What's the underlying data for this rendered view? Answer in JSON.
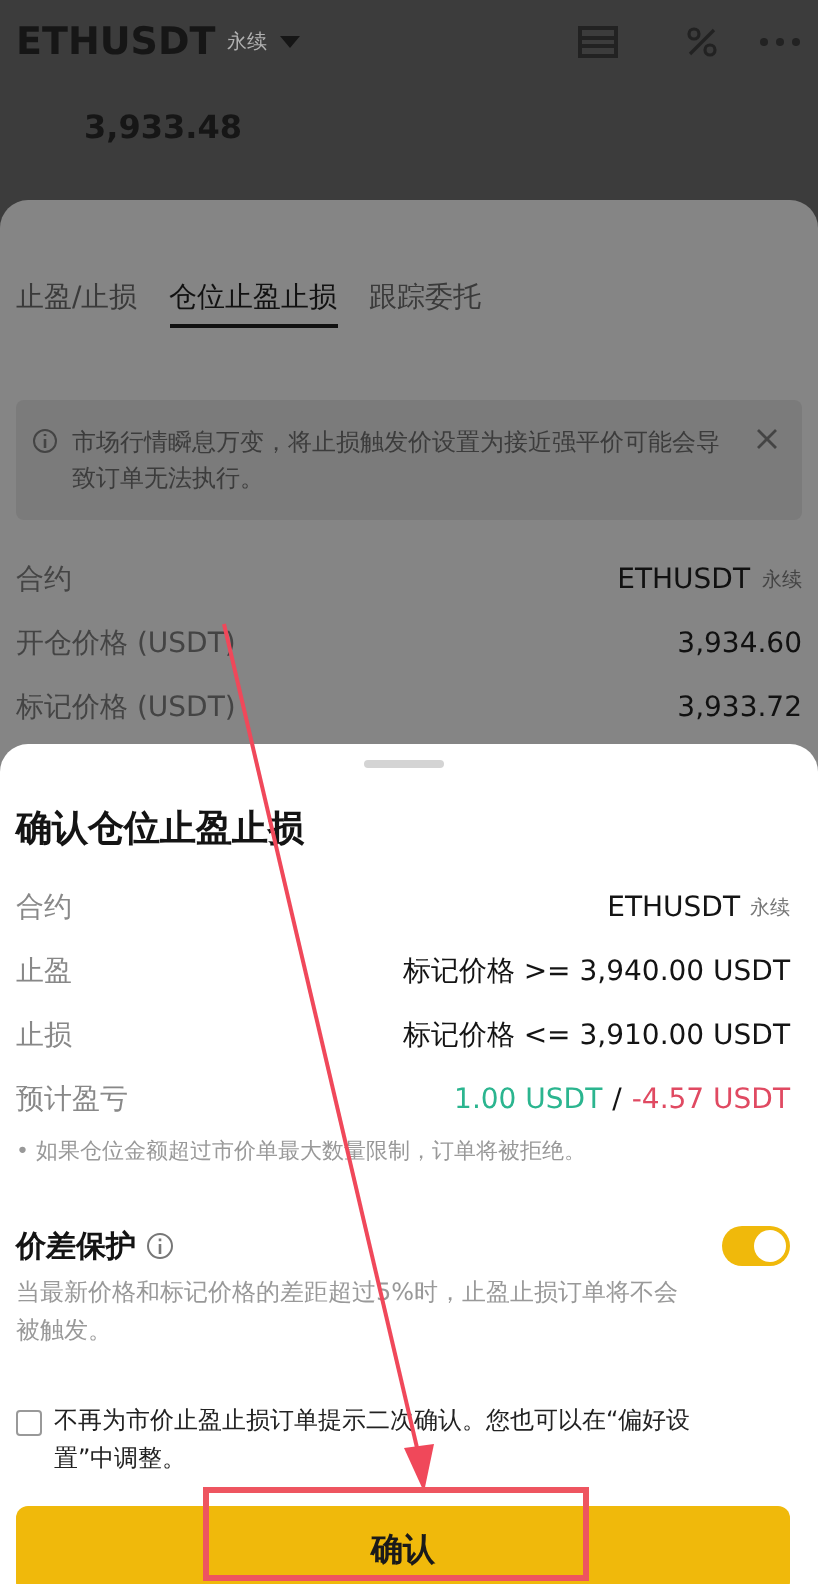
{
  "header": {
    "symbol": "ETHUSDT",
    "contract_type": "永续",
    "price": "3,933.48"
  },
  "tpsl_sheet": {
    "tabs": [
      {
        "label": "止盈/止损",
        "selected": false
      },
      {
        "label": "仓位止盈止损",
        "selected": true
      },
      {
        "label": "跟踪委托",
        "selected": false
      }
    ],
    "notice": "市场行情瞬息万变，将止损触发价设置为接近强平价可能会导致订单无法执行。",
    "rows": [
      {
        "label": "合约",
        "value": "ETHUSDT",
        "tag": "永续"
      },
      {
        "label": "开仓价格 (USDT)",
        "value": "3,934.60"
      },
      {
        "label": "标记价格 (USDT)",
        "value": "3,933.72"
      }
    ]
  },
  "confirm_dialog": {
    "title": "确认仓位止盈止损",
    "rows": [
      {
        "kind": "contract",
        "label": "合约",
        "value": "ETHUSDT",
        "tag": "永续"
      },
      {
        "kind": "plain",
        "label": "止盈",
        "value": "标记价格 >= 3,940.00 USDT"
      },
      {
        "kind": "plain",
        "label": "止损",
        "value": "标记价格 <= 3,910.00 USDT"
      },
      {
        "kind": "pnl",
        "label": "预计盈亏",
        "profit": "1.00 USDT",
        "separator": "/",
        "loss": "-4.57 USDT"
      }
    ],
    "note": "• 如果仓位金额超过市价单最大数量限制，订单将被拒绝。",
    "protection": {
      "label": "价差保护",
      "on": true,
      "description": "当最新价格和标记价格的差距超过5%时，止盈止损订单将不会被触发。"
    },
    "dont_ask": {
      "checked": false,
      "text": "不再为市价止盈止损订单提示二次确认。您也可以在“偏好设置”中调整。"
    },
    "confirm_button": "确认"
  }
}
